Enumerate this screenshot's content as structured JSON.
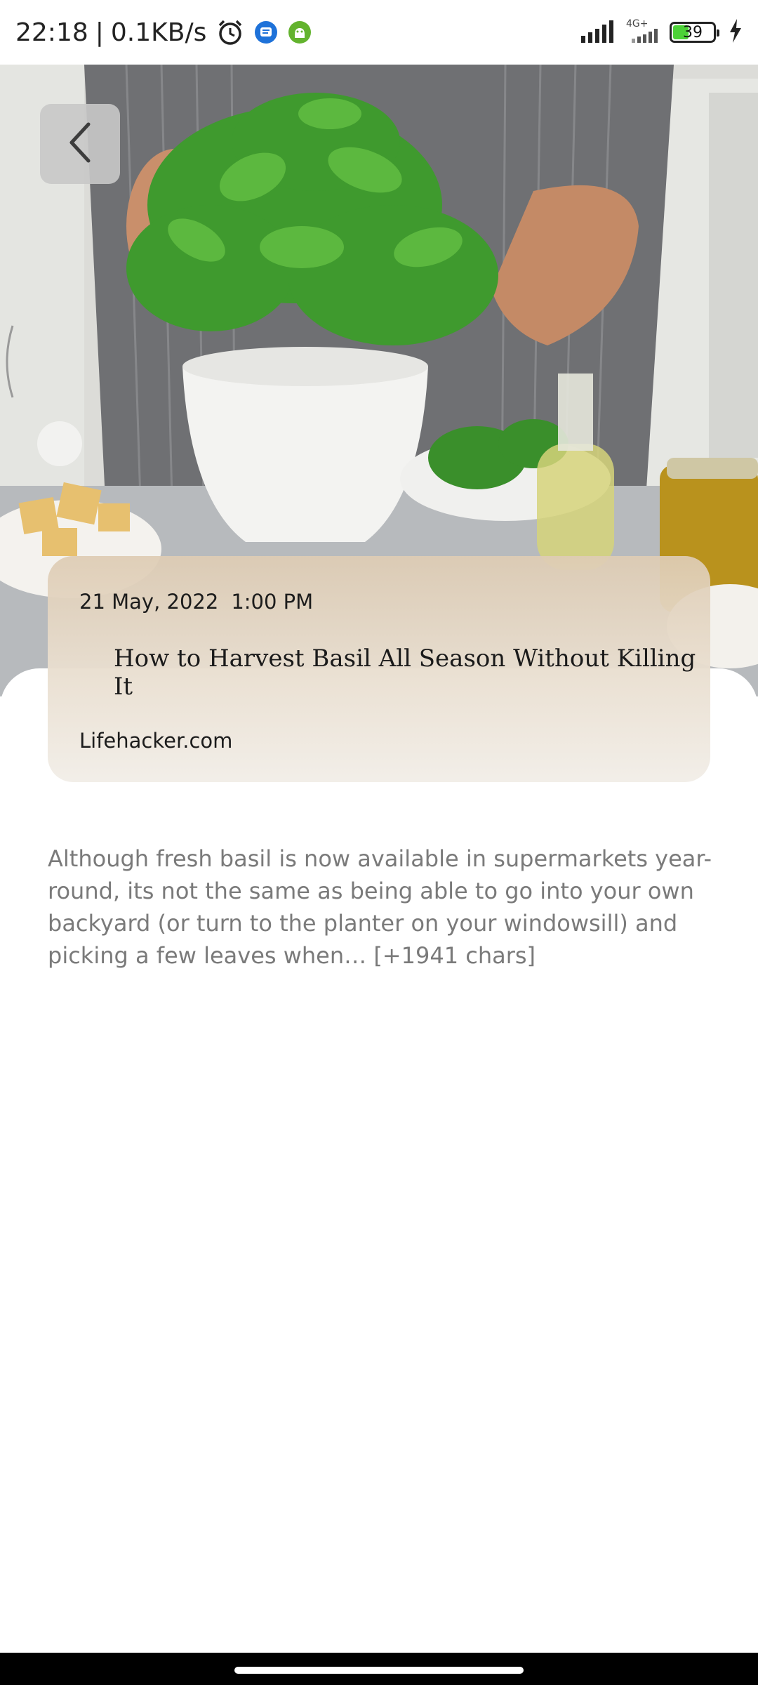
{
  "status_bar": {
    "time": "22:18",
    "separator": "|",
    "net_speed": "0.1KB/s",
    "network_type": "4G+",
    "battery_level": "39",
    "icons": [
      "alarm-icon",
      "message-app-icon",
      "android-app-icon",
      "signal-icon",
      "signal-icon-secondary",
      "battery-icon",
      "charging-icon"
    ]
  },
  "hero": {
    "icon": "basil-plant-image"
  },
  "back_button": {
    "icon": "chevron-left-icon"
  },
  "article": {
    "date": "21 May, 2022",
    "time": "1:00 PM",
    "title": "How to Harvest Basil All Season Without Killing It",
    "source": "Lifehacker.com",
    "description": "Although fresh basil is now available in supermarkets year-round, its not the same as being able to go into your own backyard (or turn to the planter on your windowsill) and picking a few leaves when… [+1941 chars]"
  },
  "colors": {
    "card_top": "#decab4",
    "card_bottom": "#f2eee8",
    "description_text": "#7a7a7a",
    "leaf_green": "#3f9a2e"
  }
}
